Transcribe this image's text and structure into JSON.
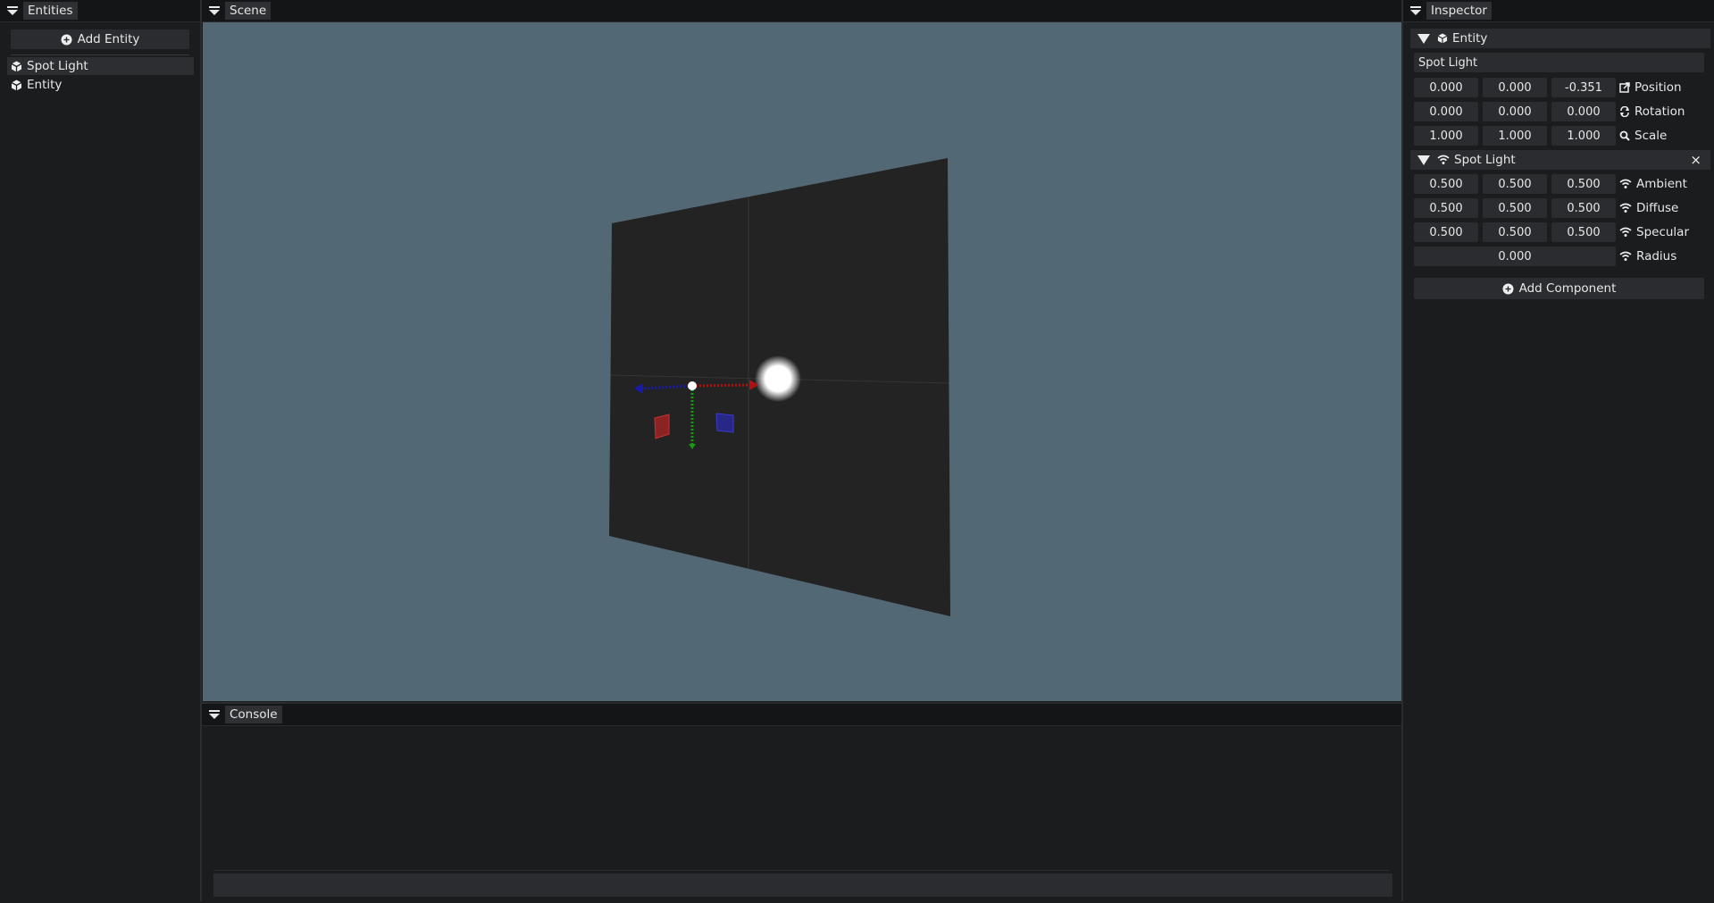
{
  "entities_panel": {
    "tab": "Entities",
    "add_button": "Add Entity",
    "items": [
      {
        "label": "Spot Light",
        "selected": true
      },
      {
        "label": "Entity",
        "selected": false
      }
    ]
  },
  "scene_panel": {
    "tab": "Scene",
    "background_color": "#526874",
    "gizmo_colors": {
      "x": "#b01010",
      "y": "#159a15",
      "z": "#1a1aa8"
    }
  },
  "console_panel": {
    "tab": "Console",
    "input_value": ""
  },
  "inspector_panel": {
    "tab": "Inspector",
    "entity_section": {
      "title": "Entity",
      "name_value": "Spot Light",
      "rows": [
        {
          "label": "Position",
          "icon": "external-link-icon",
          "values": [
            "0.000",
            "0.000",
            "-0.351"
          ]
        },
        {
          "label": "Rotation",
          "icon": "refresh-icon",
          "values": [
            "0.000",
            "0.000",
            "0.000"
          ]
        },
        {
          "label": "Scale",
          "icon": "magnify-icon",
          "values": [
            "1.000",
            "1.000",
            "1.000"
          ]
        }
      ]
    },
    "spot_light_section": {
      "title": "Spot Light",
      "close_label": "×",
      "rows": [
        {
          "label": "Ambient",
          "icon": "wifi-icon",
          "values": [
            "0.500",
            "0.500",
            "0.500"
          ]
        },
        {
          "label": "Diffuse",
          "icon": "wifi-icon",
          "values": [
            "0.500",
            "0.500",
            "0.500"
          ]
        },
        {
          "label": "Specular",
          "icon": "wifi-icon",
          "values": [
            "0.500",
            "0.500",
            "0.500"
          ]
        }
      ],
      "radius": {
        "label": "Radius",
        "icon": "wifi-icon",
        "value": "0.000"
      }
    },
    "add_component_button": "Add Component"
  }
}
